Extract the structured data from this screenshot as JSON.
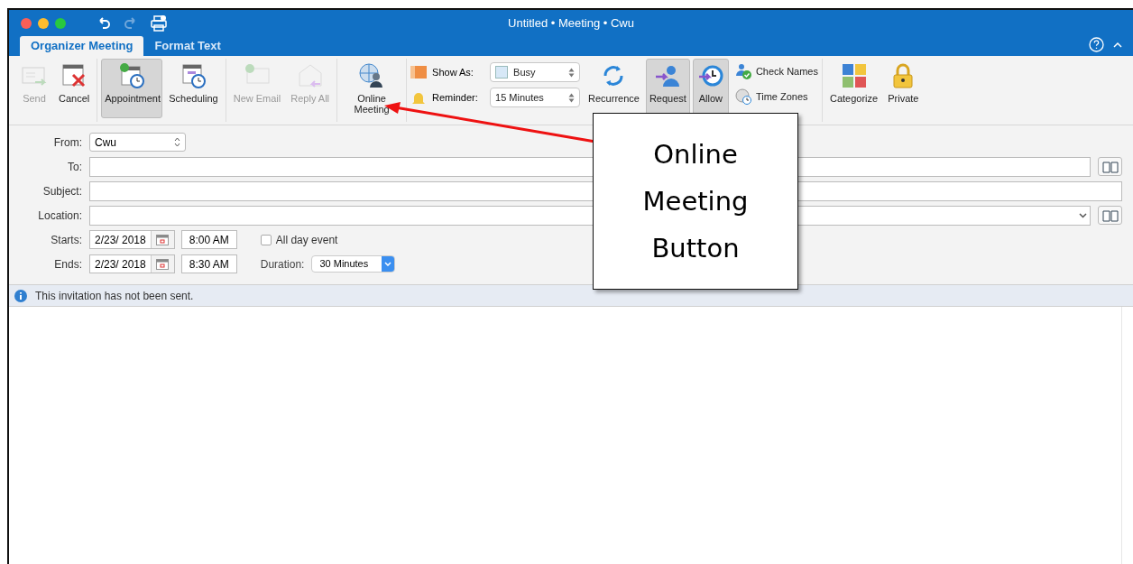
{
  "window": {
    "title": "Untitled • Meeting • Cwu"
  },
  "tabs": [
    {
      "label": "Organizer Meeting",
      "selected": true
    },
    {
      "label": "Format Text",
      "selected": false
    }
  ],
  "ribbon": [
    {
      "kind": "large",
      "items": [
        {
          "label": "Send",
          "disabled": true,
          "pressed": false
        },
        {
          "label": "Cancel",
          "disabled": false,
          "pressed": false
        }
      ]
    },
    {
      "kind": "large",
      "items": [
        {
          "label": "Appointment",
          "disabled": false,
          "pressed": true
        },
        {
          "label": "Scheduling",
          "disabled": false,
          "pressed": false
        }
      ]
    },
    {
      "kind": "large",
      "items": [
        {
          "label": "New Email",
          "disabled": true,
          "pressed": false
        },
        {
          "label": "Reply All",
          "disabled": true,
          "pressed": false
        }
      ]
    },
    {
      "kind": "large",
      "items": [
        {
          "label": "Online Meeting",
          "disabled": false,
          "pressed": false
        }
      ]
    },
    {
      "kind": "options",
      "show_as": {
        "label": "Show As:",
        "value": "Busy"
      },
      "reminder": {
        "label": "Reminder:",
        "value": "15 Minutes"
      },
      "items": [
        {
          "label": "Recurrence",
          "disabled": false,
          "pressed": false
        },
        {
          "label": "Request",
          "disabled": false,
          "pressed": true
        },
        {
          "label": "Allow",
          "disabled": false,
          "pressed": true
        }
      ],
      "small": [
        {
          "label": "Check Names"
        },
        {
          "label": "Time Zones"
        }
      ]
    },
    {
      "kind": "large",
      "items": [
        {
          "label": "Categorize",
          "disabled": false,
          "pressed": false
        },
        {
          "label": "Private",
          "disabled": false,
          "pressed": false
        }
      ]
    }
  ],
  "form": {
    "from": {
      "label": "From:",
      "value": "Cwu"
    },
    "to": {
      "label": "To:"
    },
    "subject": {
      "label": "Subject:"
    },
    "location": {
      "label": "Location:"
    },
    "starts": {
      "label": "Starts:",
      "date": "2/23/ 2018",
      "time": "8:00 AM"
    },
    "ends": {
      "label": "Ends:",
      "date": "2/23/ 2018",
      "time": "8:30 AM"
    },
    "all_day": {
      "label": "All day event",
      "checked": false
    },
    "duration": {
      "label": "Duration:",
      "value": "30 Minutes"
    }
  },
  "info_bar": {
    "text": "This invitation has not been sent."
  },
  "callout": {
    "text": "Online Meeting Button"
  }
}
